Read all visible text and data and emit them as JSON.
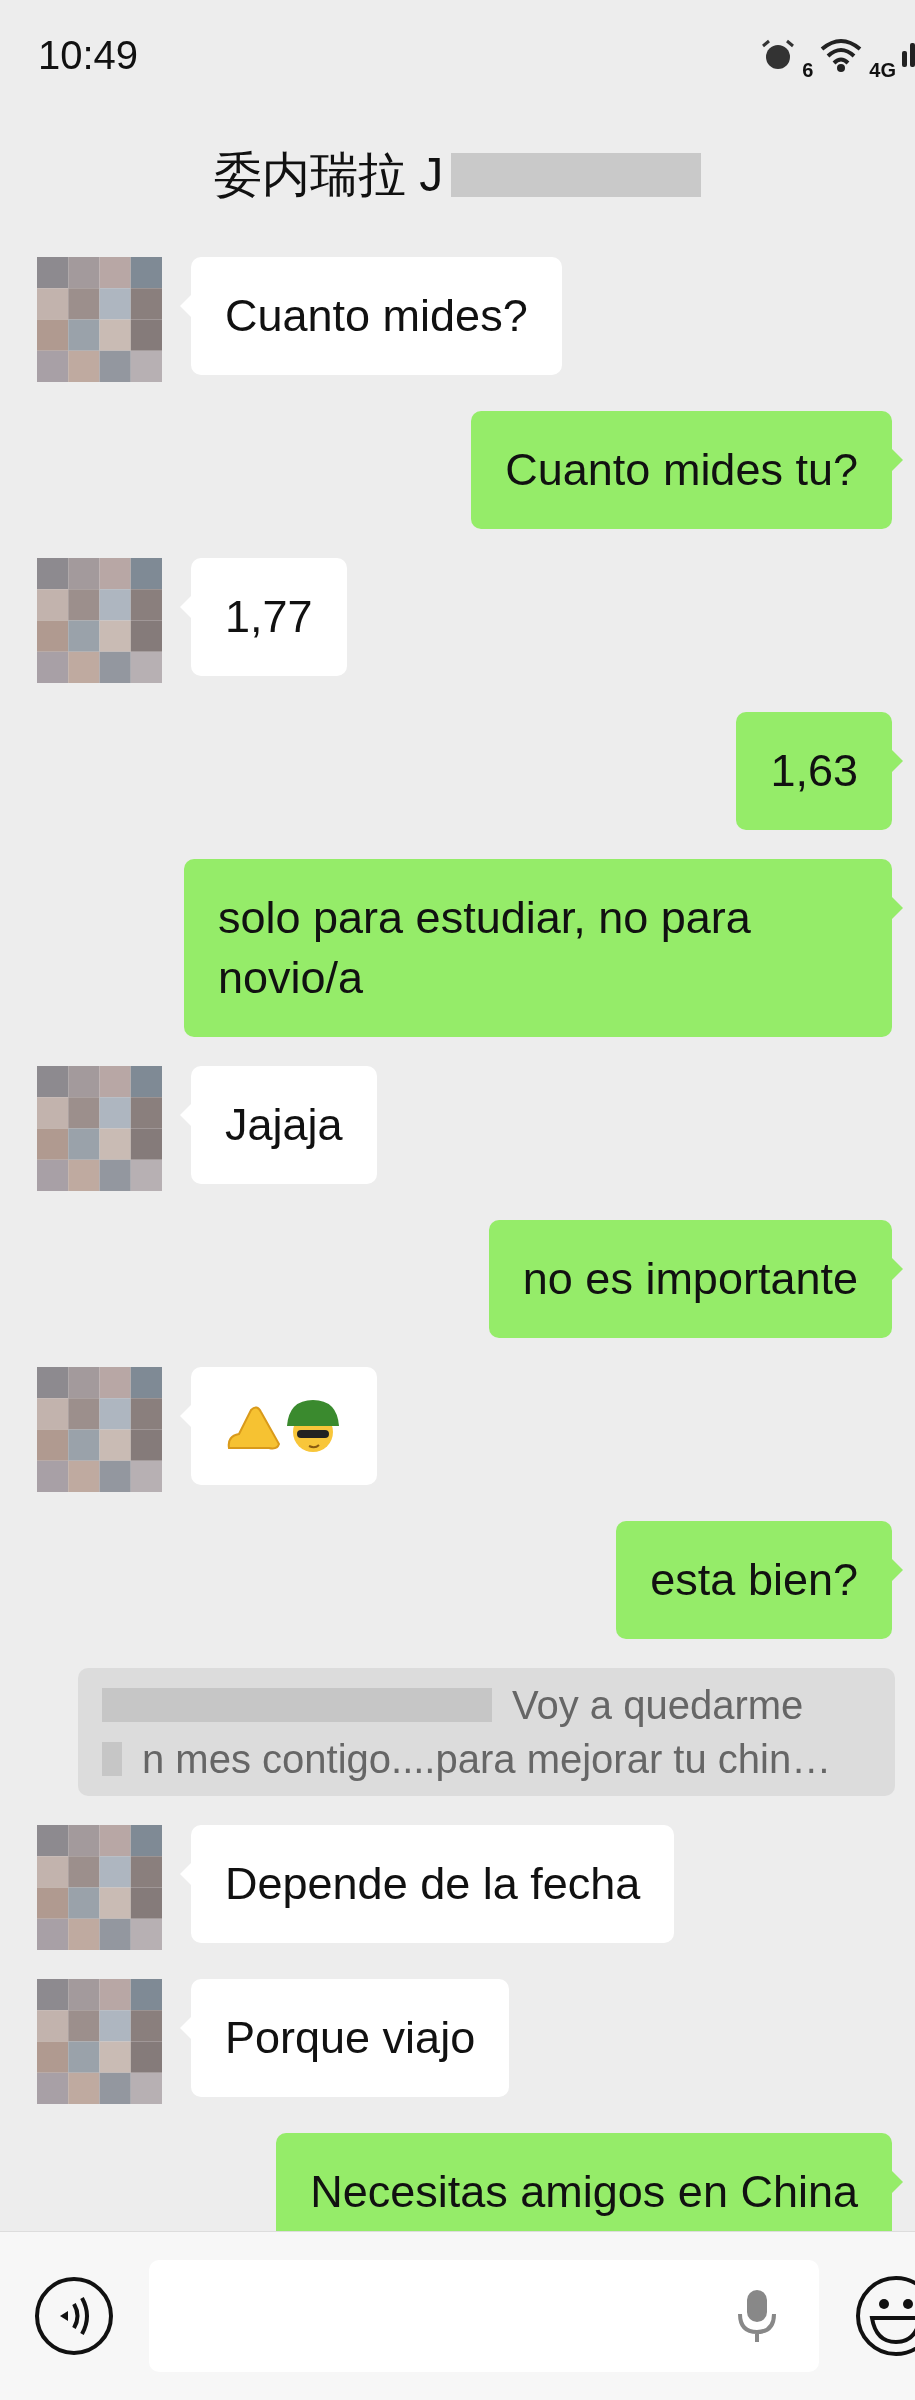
{
  "status_bar": {
    "time": "10:49",
    "wifi_label": "6",
    "network": "4G"
  },
  "header": {
    "title": "委内瑞拉 J"
  },
  "messages": [
    {
      "kind": "incoming",
      "text": "Cuanto mides?"
    },
    {
      "kind": "outgoing",
      "text": "Cuanto mides tu?"
    },
    {
      "kind": "incoming",
      "text": "1,77"
    },
    {
      "kind": "outgoing",
      "text": "1,63"
    },
    {
      "kind": "outgoing",
      "text": "solo para estudiar, no para novio/a"
    },
    {
      "kind": "incoming",
      "text": "Jajaja"
    },
    {
      "kind": "outgoing",
      "text": "no es importante"
    },
    {
      "kind": "sticker"
    },
    {
      "kind": "outgoing",
      "text": "esta bien?"
    },
    {
      "kind": "quote",
      "lines": [
        "Voy a quedarme",
        "n mes contigo....para mejorar tu chin…"
      ]
    },
    {
      "kind": "incoming",
      "text": "Depende de la fecha"
    },
    {
      "kind": "incoming",
      "text": "Porque viajo"
    },
    {
      "kind": "outgoing",
      "text": "Necesitas amigos en China"
    }
  ]
}
